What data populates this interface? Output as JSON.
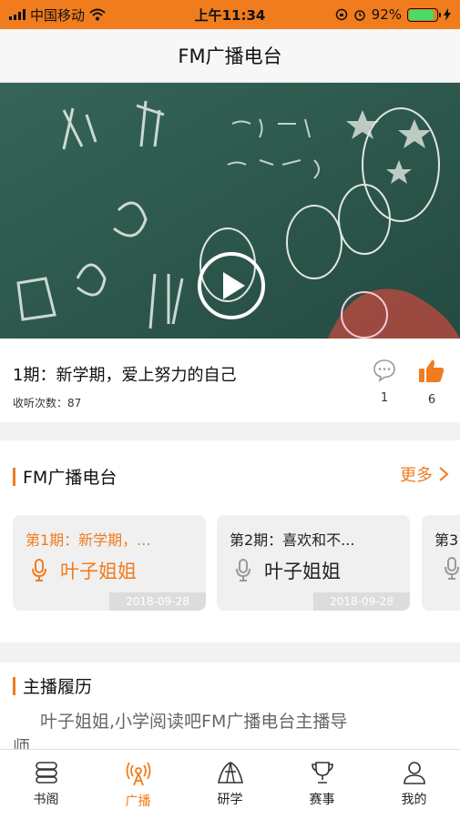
{
  "status": {
    "carrier": "中国移动",
    "time": "上午11:34",
    "battery": "92%"
  },
  "nav": {
    "title": "FM广播电台"
  },
  "episode": {
    "title": "1期：新学期，爱上努力的自己",
    "listen_count": "收听次数：87",
    "comments": "1",
    "likes": "6"
  },
  "fm": {
    "title": "FM广播电台",
    "more": "更多",
    "cards": [
      {
        "title": "第1期：新学期，...",
        "host": "叶子姐姐",
        "date": "2018-09-28"
      },
      {
        "title": "第2期：喜欢和不...",
        "host": "叶子姐姐",
        "date": "2018-09-28"
      },
      {
        "title": "第3",
        "host": "",
        "date": ""
      }
    ]
  },
  "anchor": {
    "title": "主播履历",
    "text_line1": "叶子姐姐,小学阅读吧FM广播电台主播导",
    "text_line2": "师"
  },
  "tabs": [
    {
      "label": "书阁",
      "icon": "books-icon"
    },
    {
      "label": "广播",
      "icon": "broadcast-icon"
    },
    {
      "label": "研学",
      "icon": "tent-icon"
    },
    {
      "label": "赛事",
      "icon": "trophy-icon"
    },
    {
      "label": "我的",
      "icon": "user-icon"
    }
  ],
  "colors": {
    "accent": "#f07c1e",
    "statusbar": "#f07c1e",
    "battery": "#4cd964"
  }
}
